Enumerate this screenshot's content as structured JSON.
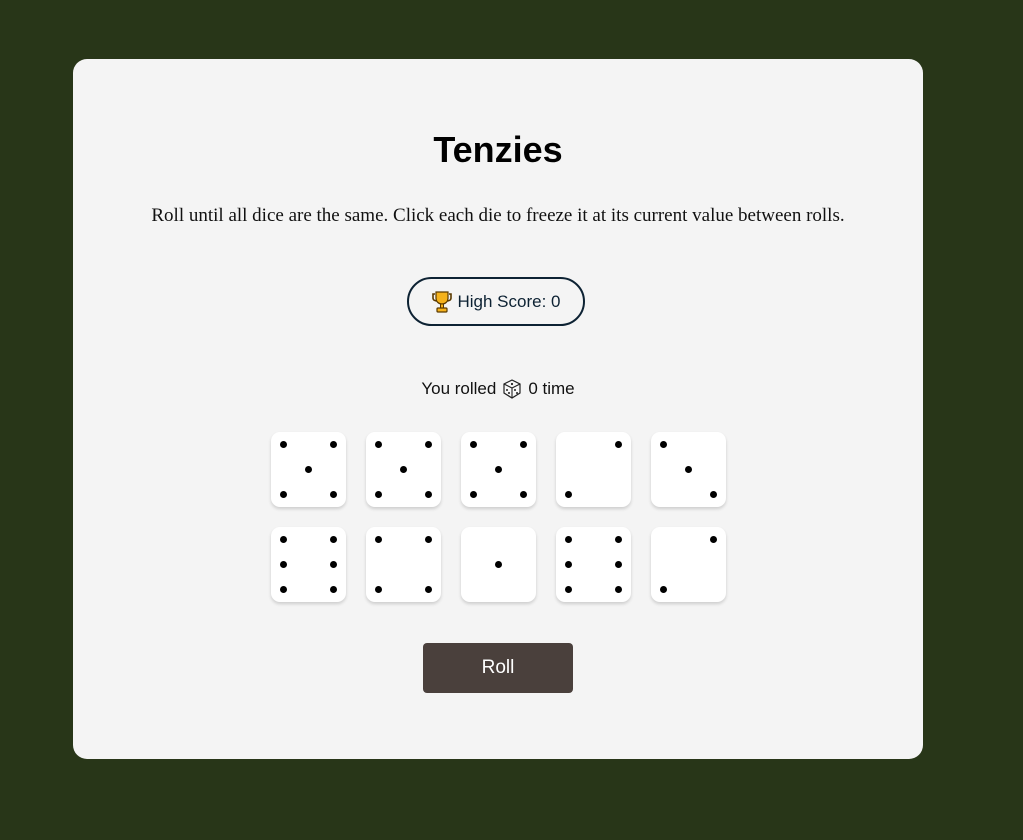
{
  "game": {
    "title": "Tenzies",
    "instructions": "Roll until all dice are the same. Click each die to freeze it at its current value between rolls.",
    "high_score_label": "High Score: 0",
    "high_score_icon": "trophy-icon",
    "rolled_prefix": "You rolled",
    "rolled_icon": "die-icon",
    "rolled_suffix": "0 time",
    "roll_button_label": "Roll"
  },
  "dice": [
    {
      "value": 5,
      "held": false
    },
    {
      "value": 5,
      "held": false
    },
    {
      "value": 5,
      "held": false
    },
    {
      "value": 2,
      "held": false
    },
    {
      "value": 3,
      "held": false
    },
    {
      "value": 6,
      "held": false
    },
    {
      "value": 4,
      "held": false
    },
    {
      "value": 1,
      "held": false
    },
    {
      "value": 6,
      "held": false
    },
    {
      "value": 2,
      "held": false
    }
  ],
  "colors": {
    "page_background": "#283618",
    "card_background": "#f4f4f4",
    "roll_button": "#4a403c",
    "high_score_border": "#0d2233",
    "die_face": "#ffffff",
    "pip": "#000000"
  }
}
